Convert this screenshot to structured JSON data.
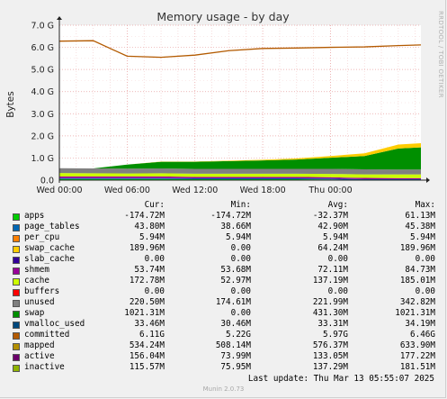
{
  "side_label": "RRDTOOL / TOBI OETIKER",
  "legend_headers": {
    "cur": "Cur:",
    "min": "Min:",
    "avg": "Avg:",
    "max": "Max:"
  },
  "legend": [
    {
      "name": "apps",
      "color": "#00cc00",
      "cur": "-174.72M",
      "min": "-174.72M",
      "avg": "-32.37M",
      "max": "61.13M"
    },
    {
      "name": "page_tables",
      "color": "#0066b3",
      "cur": "43.80M",
      "min": "38.66M",
      "avg": "42.90M",
      "max": "45.38M"
    },
    {
      "name": "per_cpu",
      "color": "#ff8000",
      "cur": "5.94M",
      "min": "5.94M",
      "avg": "5.94M",
      "max": "5.94M"
    },
    {
      "name": "swap_cache",
      "color": "#ffcc00",
      "cur": "189.96M",
      "min": "0.00",
      "avg": "64.24M",
      "max": "189.96M"
    },
    {
      "name": "slab_cache",
      "color": "#330099",
      "cur": "0.00",
      "min": "0.00",
      "avg": "0.00",
      "max": "0.00"
    },
    {
      "name": "shmem",
      "color": "#990099",
      "cur": "53.74M",
      "min": "53.68M",
      "avg": "72.11M",
      "max": "84.73M"
    },
    {
      "name": "cache",
      "color": "#ccff00",
      "cur": "172.78M",
      "min": "52.97M",
      "avg": "137.19M",
      "max": "185.01M"
    },
    {
      "name": "buffers",
      "color": "#ff0000",
      "cur": "0.00",
      "min": "0.00",
      "avg": "0.00",
      "max": "0.00"
    },
    {
      "name": "unused",
      "color": "#808080",
      "cur": "220.50M",
      "min": "174.61M",
      "avg": "221.99M",
      "max": "342.82M"
    },
    {
      "name": "swap",
      "color": "#008f00",
      "cur": "1021.31M",
      "min": "0.00",
      "avg": "431.30M",
      "max": "1021.31M"
    },
    {
      "name": "vmalloc_used",
      "color": "#00487d",
      "cur": "33.46M",
      "min": "30.46M",
      "avg": "33.31M",
      "max": "34.19M"
    },
    {
      "name": "committed",
      "color": "#b35a00",
      "cur": "6.11G",
      "min": "5.22G",
      "avg": "5.97G",
      "max": "6.46G"
    },
    {
      "name": "mapped",
      "color": "#b38f00",
      "cur": "534.24M",
      "min": "508.14M",
      "avg": "576.37M",
      "max": "633.90M"
    },
    {
      "name": "active",
      "color": "#6b006b",
      "cur": "156.04M",
      "min": "73.99M",
      "avg": "133.05M",
      "max": "177.22M"
    },
    {
      "name": "inactive",
      "color": "#8fb300",
      "cur": "115.57M",
      "min": "75.95M",
      "avg": "137.29M",
      "max": "181.51M"
    }
  ],
  "footer": {
    "last_update": "Last update: Thu Mar 13 05:55:07 2025",
    "munin": "Munin 2.0.73"
  },
  "chart_data": {
    "type": "area",
    "title": "Memory usage - by day",
    "ylabel": "Bytes",
    "xlabel": "",
    "ylim": [
      0,
      7.0
    ],
    "y_unit": "G",
    "y_ticks": [
      "0.0",
      "1.0 G",
      "2.0 G",
      "3.0 G",
      "4.0 G",
      "5.0 G",
      "6.0 G",
      "7.0 G"
    ],
    "x_tick_labels": [
      "Wed 00:00",
      "Wed 06:00",
      "Wed 12:00",
      "Wed 18:00",
      "Thu 00:00"
    ],
    "grid": true,
    "x_hours": [
      0,
      3,
      6,
      9,
      12,
      15,
      18,
      21,
      24,
      27,
      30,
      32
    ],
    "stacked_series": [
      {
        "name": "apps",
        "values": [
          0.05,
          0.05,
          0.05,
          0.05,
          0.04,
          0.04,
          0.04,
          0.04,
          0.03,
          0.0,
          0.0,
          0.0
        ]
      },
      {
        "name": "page_tables",
        "values": [
          0.04,
          0.04,
          0.04,
          0.04,
          0.04,
          0.04,
          0.04,
          0.04,
          0.04,
          0.04,
          0.04,
          0.04
        ]
      },
      {
        "name": "shmem",
        "values": [
          0.08,
          0.08,
          0.08,
          0.08,
          0.07,
          0.07,
          0.07,
          0.07,
          0.06,
          0.06,
          0.05,
          0.05
        ]
      },
      {
        "name": "cache",
        "values": [
          0.15,
          0.14,
          0.13,
          0.14,
          0.14,
          0.14,
          0.14,
          0.14,
          0.15,
          0.16,
          0.17,
          0.17
        ]
      },
      {
        "name": "unused",
        "values": [
          0.22,
          0.22,
          0.22,
          0.22,
          0.22,
          0.22,
          0.22,
          0.22,
          0.23,
          0.23,
          0.22,
          0.22
        ]
      },
      {
        "name": "swap",
        "values": [
          0.0,
          0.0,
          0.18,
          0.3,
          0.32,
          0.35,
          0.38,
          0.42,
          0.5,
          0.6,
          0.95,
          1.0
        ]
      },
      {
        "name": "swap_cache",
        "values": [
          0.0,
          0.0,
          0.0,
          0.01,
          0.01,
          0.02,
          0.03,
          0.05,
          0.08,
          0.12,
          0.18,
          0.19
        ]
      }
    ],
    "line_series": {
      "name": "committed",
      "values": [
        6.28,
        6.3,
        5.6,
        5.55,
        5.65,
        5.85,
        5.95,
        5.97,
        6.0,
        6.02,
        6.08,
        6.11
      ]
    }
  }
}
